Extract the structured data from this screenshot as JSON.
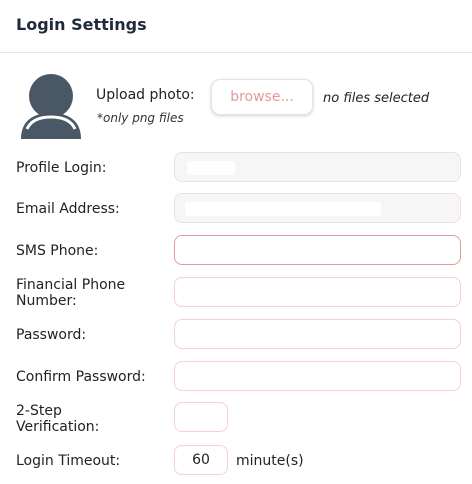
{
  "page": {
    "title": "Login Settings"
  },
  "upload": {
    "label": "Upload photo:",
    "note": "*only png files",
    "browse_label": "browse...",
    "status": "no files selected"
  },
  "fields": {
    "profile_login": {
      "label": "Profile Login:"
    },
    "email": {
      "label": "Email Address:"
    },
    "sms_phone": {
      "label": "SMS Phone:",
      "value": ""
    },
    "financial_phone": {
      "label_line1": "Financial Phone",
      "label_line2": "Number:",
      "value": ""
    },
    "password": {
      "label": "Password:",
      "value": ""
    },
    "confirm_password": {
      "label": "Confirm Password:",
      "value": ""
    },
    "two_step": {
      "label_line1": "2-Step",
      "label_line2": "Verification:"
    },
    "login_timeout": {
      "label": "Login Timeout:",
      "value": "60",
      "unit": "minute(s)"
    }
  },
  "icons": {
    "avatar": "user-avatar-icon"
  },
  "colors": {
    "title": "#1f2a3a",
    "browse_text": "#e59a9a",
    "focus_border": "#e79a9a",
    "field_border": "#f2d2d2",
    "avatar": "#4a5865"
  }
}
